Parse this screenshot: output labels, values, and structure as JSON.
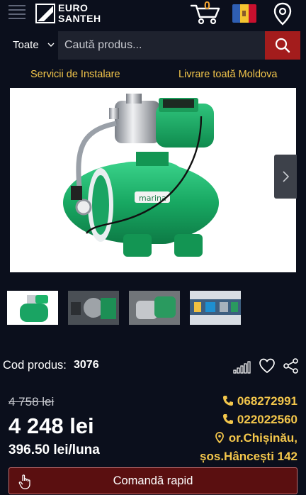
{
  "header": {
    "logo_line1": "EURO",
    "logo_line2": "SANTEH",
    "cart_count": "0",
    "flag_colors": [
      "#2f5fb3",
      "#f4c430",
      "#c8102e"
    ],
    "icons": [
      "menu-icon",
      "cart-icon",
      "location-pin-icon"
    ]
  },
  "search": {
    "category": "Toate",
    "placeholder": "Caută produs..."
  },
  "infobar": {
    "left": "Servicii de Instalare",
    "right": "Livrare toată Moldova"
  },
  "product": {
    "image_brand_text": "marina",
    "code_label": "Cod produs:",
    "code_value": "3076",
    "old_price": "4 758 lei",
    "price": "4 248 lei",
    "monthly": "396.50 lei/luna"
  },
  "contacts": {
    "phone1": "068272991",
    "phone2": "022022560",
    "city": "or.Chișinău,",
    "street": "șos.Hâncești 142"
  },
  "order_button": "Comandă rapid",
  "colors": {
    "background": "#0b0f1c",
    "accent_yellow": "#f3c64b",
    "search_button": "#a31c1c",
    "order_button": "#5a0f10",
    "pump_green": "#1fb06a"
  }
}
